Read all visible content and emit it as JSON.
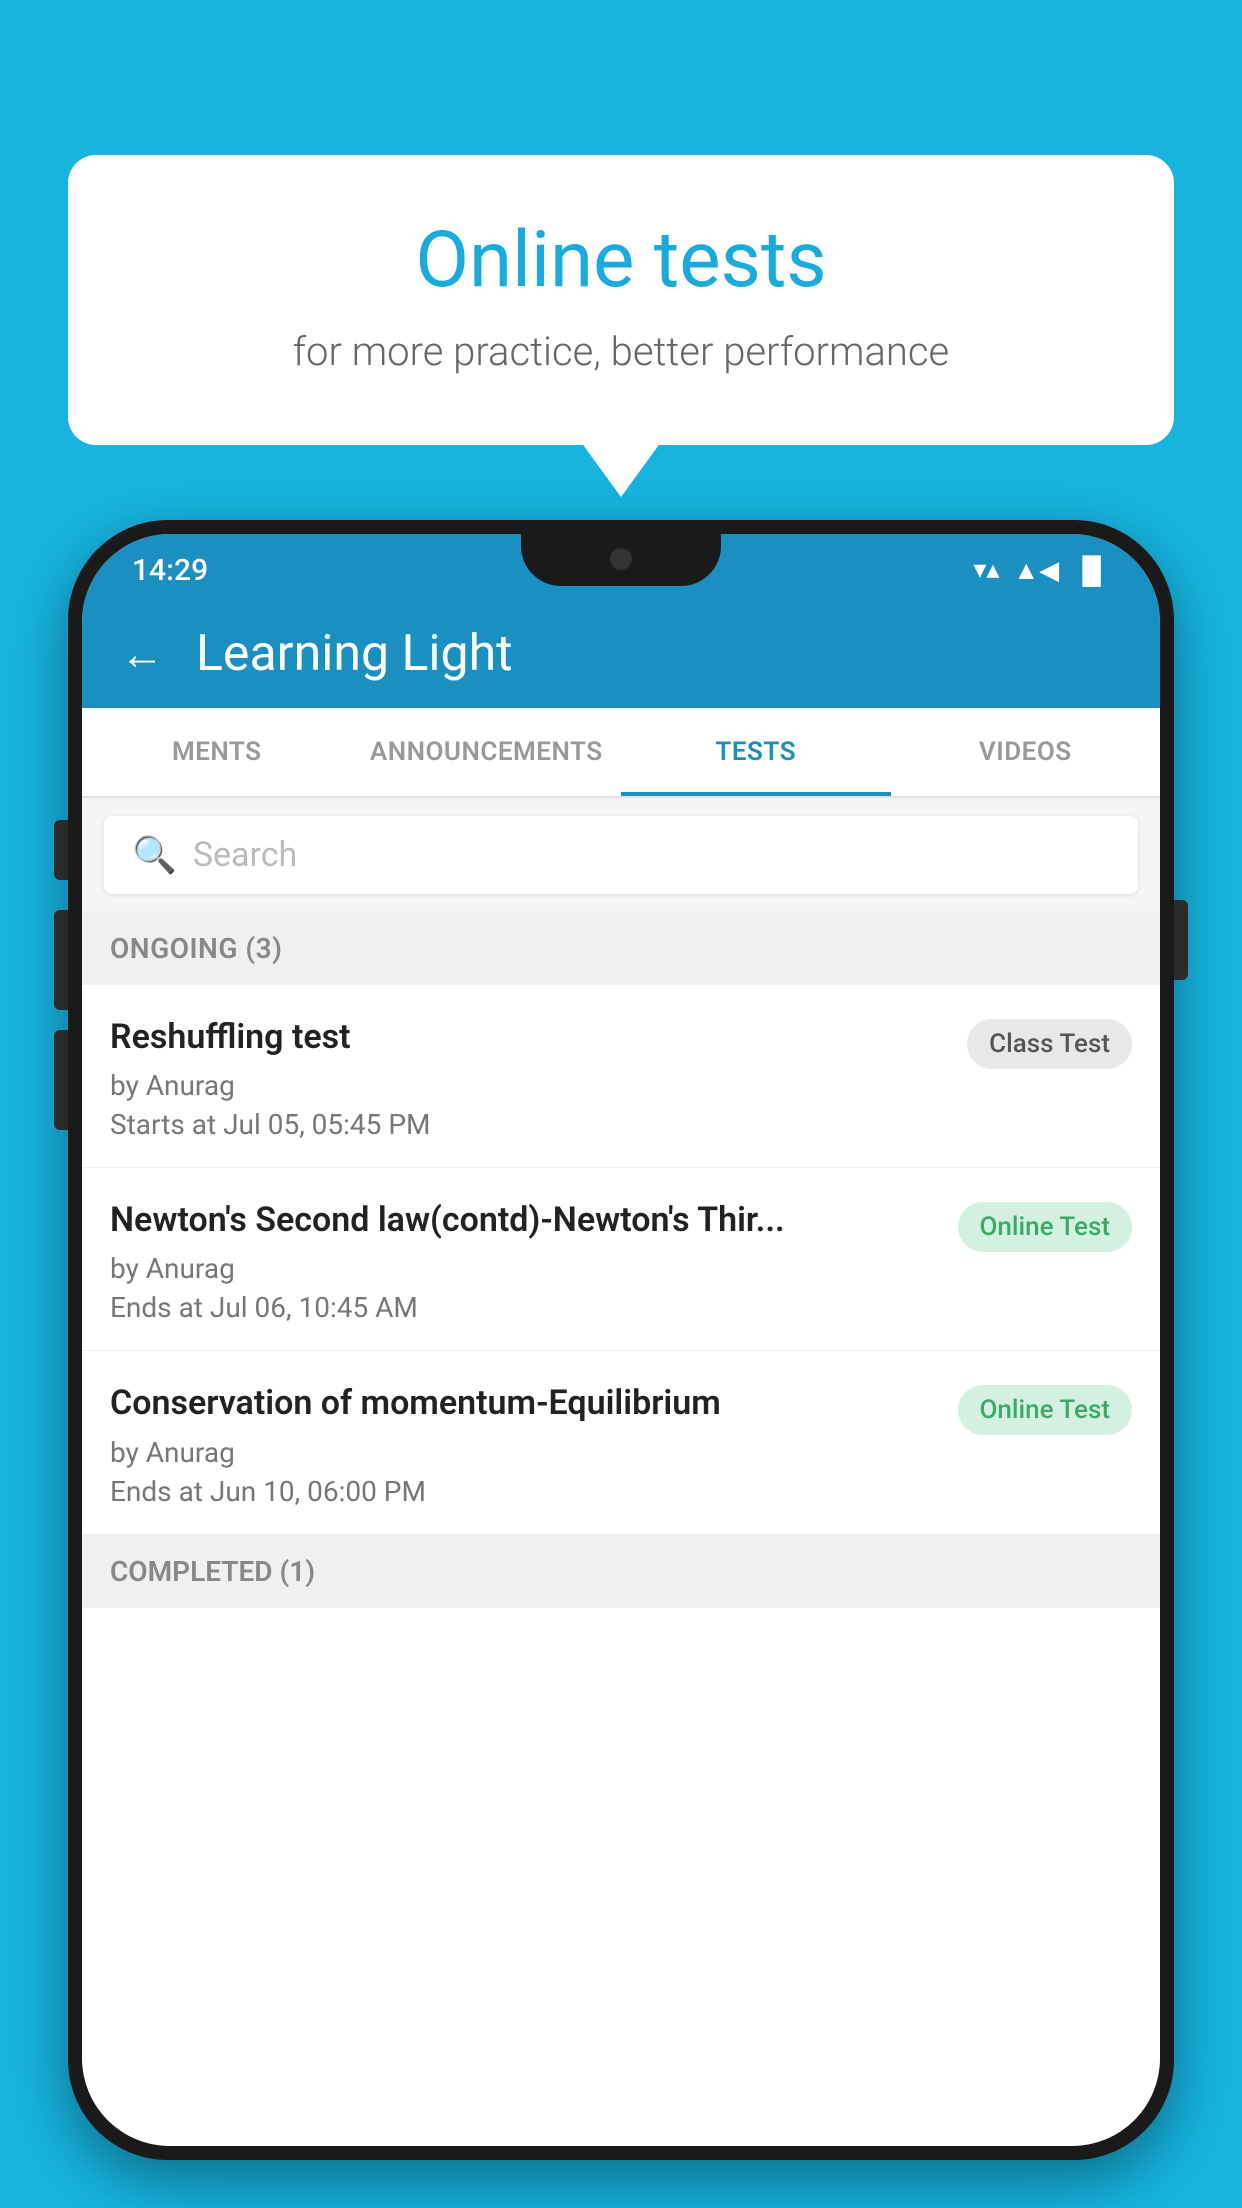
{
  "background_color": "#17b4e0",
  "promo": {
    "title": "Online tests",
    "subtitle": "for more practice, better performance"
  },
  "status_bar": {
    "time": "14:29",
    "wifi": "▼",
    "signal": "▲",
    "battery": "▐"
  },
  "app_bar": {
    "title": "Learning Light",
    "back_arrow": "←"
  },
  "tabs": [
    {
      "label": "MENTS",
      "active": false
    },
    {
      "label": "ANNOUNCEMENTS",
      "active": false
    },
    {
      "label": "TESTS",
      "active": true
    },
    {
      "label": "VIDEOS",
      "active": false
    }
  ],
  "search": {
    "placeholder": "Search"
  },
  "ongoing_section": {
    "label": "ONGOING (3)"
  },
  "tests": [
    {
      "name": "Reshuffling test",
      "by": "by Anurag",
      "time": "Starts at  Jul 05, 05:45 PM",
      "badge": "Class Test",
      "badge_type": "class"
    },
    {
      "name": "Newton's Second law(contd)-Newton's Thir...",
      "by": "by Anurag",
      "time": "Ends at  Jul 06, 10:45 AM",
      "badge": "Online Test",
      "badge_type": "online"
    },
    {
      "name": "Conservation of momentum-Equilibrium",
      "by": "by Anurag",
      "time": "Ends at  Jun 10, 06:00 PM",
      "badge": "Online Test",
      "badge_type": "online"
    }
  ],
  "completed_section": {
    "label": "COMPLETED (1)"
  }
}
